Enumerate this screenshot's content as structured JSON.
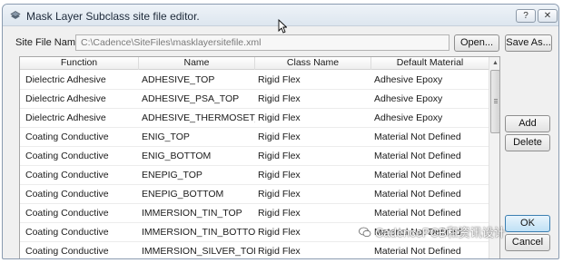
{
  "window": {
    "title": "Mask Layer Subclass site file editor.",
    "help_label": "?",
    "close_label": "✕"
  },
  "site_file": {
    "label": "Site File Name:",
    "value": "C:\\Cadence\\SiteFiles\\masklayersitefile.xml"
  },
  "buttons": {
    "open": "Open...",
    "save_as": "Save As...",
    "add": "Add",
    "delete": "Delete",
    "ok": "OK",
    "cancel": "Cancel"
  },
  "table": {
    "columns": [
      "Function",
      "Name",
      "Class Name",
      "Default Material"
    ],
    "rows": [
      [
        "Dielectric Adhesive",
        "ADHESIVE_TOP",
        "Rigid Flex",
        "Adhesive Epoxy"
      ],
      [
        "Dielectric Adhesive",
        "ADHESIVE_PSA_TOP",
        "Rigid Flex",
        "Adhesive Epoxy"
      ],
      [
        "Dielectric Adhesive",
        "ADHESIVE_THERMOSET_TOP",
        "Rigid Flex",
        "Adhesive Epoxy"
      ],
      [
        "Coating Conductive",
        "ENIG_TOP",
        "Rigid Flex",
        "Material Not Defined"
      ],
      [
        "Coating Conductive",
        "ENIG_BOTTOM",
        "Rigid Flex",
        "Material Not Defined"
      ],
      [
        "Coating Conductive",
        "ENEPIG_TOP",
        "Rigid Flex",
        "Material Not Defined"
      ],
      [
        "Coating Conductive",
        "ENEPIG_BOTTOM",
        "Rigid Flex",
        "Material Not Defined"
      ],
      [
        "Coating Conductive",
        "IMMERSION_TIN_TOP",
        "Rigid Flex",
        "Material Not Defined"
      ],
      [
        "Coating Conductive",
        "IMMERSION_TIN_BOTTOM",
        "Rigid Flex",
        "Material Not Defined"
      ],
      [
        "Coating Conductive",
        "IMMERSION_SILVER_TOP",
        "Rigid Flex",
        "Material Not Defined"
      ]
    ]
  },
  "watermark": {
    "text": "CadencePCB和资讯设计"
  },
  "colors": {
    "window_border": "#8a9bb0",
    "ok_accent": "#3c7fb1"
  }
}
